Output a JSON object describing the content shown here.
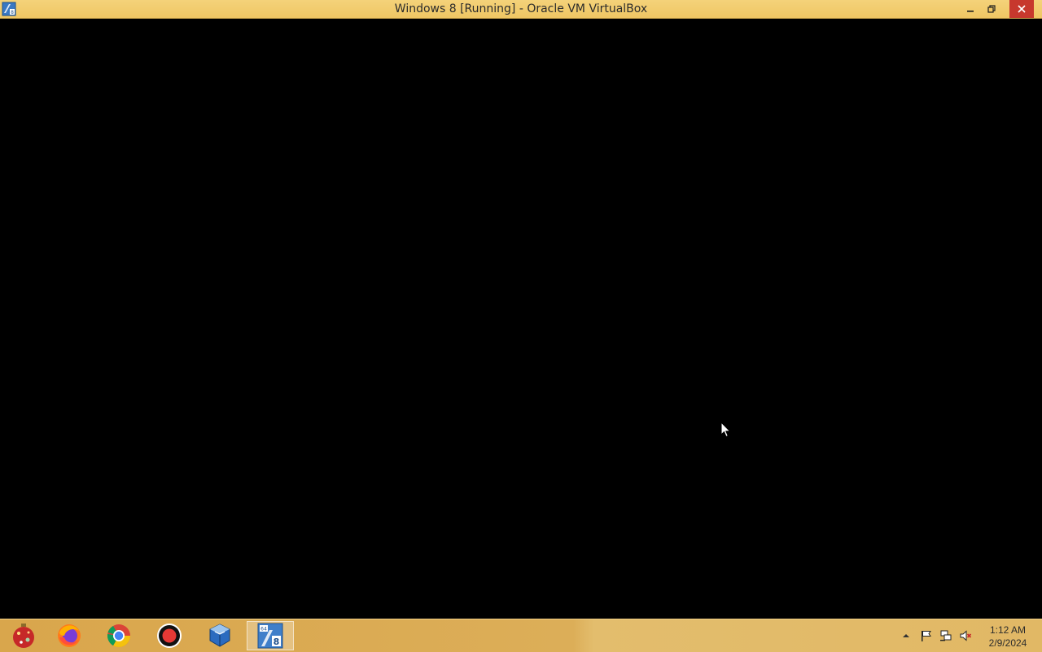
{
  "window": {
    "title": "Windows 8 [Running] - Oracle VM VirtualBox",
    "controls": [
      "minimize",
      "restore",
      "close"
    ]
  },
  "taskbar": {
    "pinned": [
      {
        "name": "ornament-app",
        "icon": "ornament-icon"
      },
      {
        "name": "firefox",
        "icon": "firefox-icon"
      },
      {
        "name": "chrome",
        "icon": "chrome-icon"
      },
      {
        "name": "screen-recorder",
        "icon": "record-icon"
      },
      {
        "name": "virtualbox-manager",
        "icon": "virtualbox-icon"
      },
      {
        "name": "windows-8-vm",
        "icon": "vm-windows8-icon",
        "active": true
      }
    ],
    "tray": {
      "icons": [
        "show-hidden-icons-arrow",
        "action-center-flag-icon",
        "network-icon",
        "volume-muted-icon"
      ],
      "time": "1:12 AM",
      "date": "2/9/2024"
    }
  },
  "colors": {
    "titlebar": "#efc664",
    "taskbar": "#d9a64c",
    "close": "#c7382d",
    "vm_screen": "#000000"
  }
}
